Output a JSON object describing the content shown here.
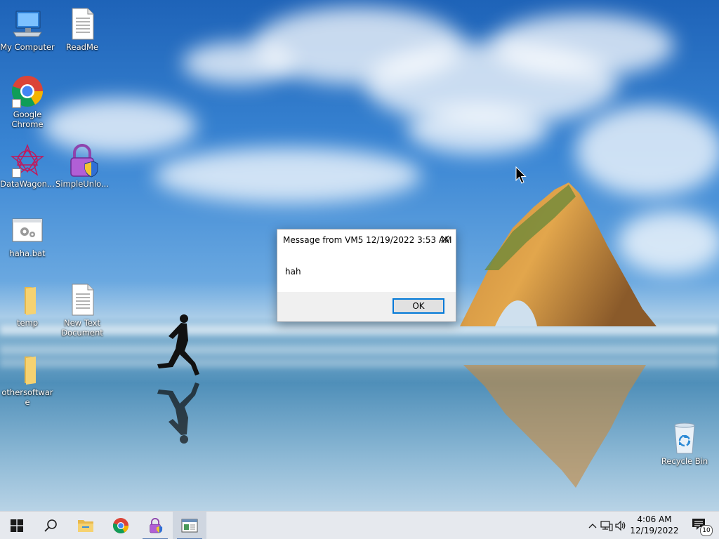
{
  "desktop": {
    "icons": [
      {
        "id": "my-computer",
        "label": "My Computer",
        "icon": "computer-icon"
      },
      {
        "id": "readme",
        "label": "ReadMe",
        "icon": "text-file-icon"
      },
      {
        "id": "google-chrome",
        "label": "Google Chrome",
        "icon": "chrome-icon"
      },
      {
        "id": "datawagon",
        "label": "DataWagon...",
        "icon": "datawagon-icon"
      },
      {
        "id": "simpleunlocker",
        "label": "SimpleUnlo...",
        "icon": "lock-shield-icon"
      },
      {
        "id": "haha-bat",
        "label": "haha.bat",
        "icon": "batch-file-icon"
      },
      {
        "id": "temp",
        "label": "temp",
        "icon": "folder-icon"
      },
      {
        "id": "new-text-document",
        "label": "New Text Document",
        "icon": "text-file-icon"
      },
      {
        "id": "othersoftware",
        "label": "othersoftware",
        "icon": "folder-icon"
      },
      {
        "id": "recycle-bin",
        "label": "Recycle Bin",
        "icon": "recycle-bin-icon"
      }
    ]
  },
  "dialog": {
    "title": "Message from VM5 12/19/2022 3:53 AM",
    "message": "hah",
    "ok_label": "OK"
  },
  "taskbar": {
    "items": [
      {
        "name": "start-button",
        "icon": "windows-logo-icon"
      },
      {
        "name": "search-button",
        "icon": "search-icon"
      },
      {
        "name": "file-explorer-button",
        "icon": "folder-icon"
      },
      {
        "name": "chrome-taskbar-button",
        "icon": "chrome-icon"
      },
      {
        "name": "simpleunlocker-taskbar-button",
        "icon": "lock-shield-icon"
      },
      {
        "name": "message-window-taskbar-button",
        "icon": "window-icon"
      }
    ],
    "clock": {
      "time": "4:06 AM",
      "date": "12/19/2022"
    },
    "notifications": {
      "count": "10"
    }
  },
  "colors": {
    "taskbar_bg": "#e6e9ee",
    "accent": "#0078d7",
    "dialog_footer": "#f0f0f0"
  }
}
